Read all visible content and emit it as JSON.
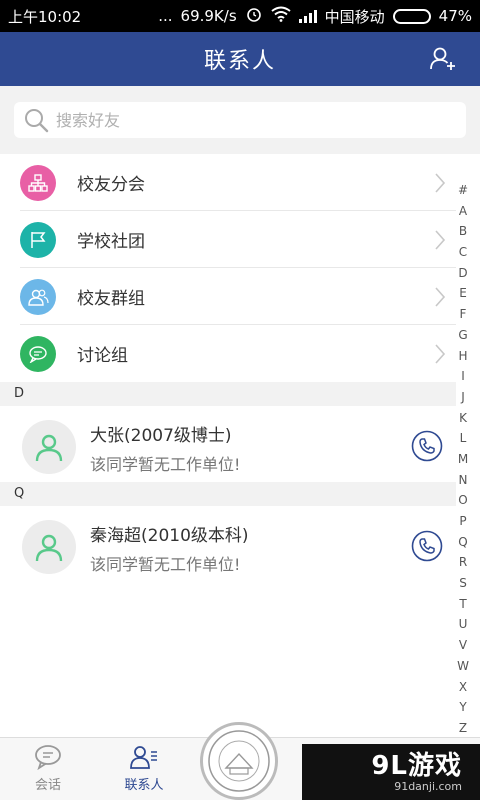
{
  "status_bar": {
    "time": "上午10:02",
    "dots": "...",
    "speed": "69.9K/s",
    "carrier": "中国移动",
    "battery": "47%",
    "battery_level": 0.47
  },
  "header": {
    "title": "联系人"
  },
  "search": {
    "placeholder": "搜索好友"
  },
  "groups": [
    {
      "label": "校友分会",
      "icon": "org-chart-icon",
      "color": "#e85fa5"
    },
    {
      "label": "学校社团",
      "icon": "flag-icon",
      "color": "#1db3a8"
    },
    {
      "label": "校友群组",
      "icon": "group-icon",
      "color": "#6cb7e8"
    },
    {
      "label": "讨论组",
      "icon": "chat-bubble-icon",
      "color": "#2fb561"
    }
  ],
  "sections": [
    {
      "letter": "D",
      "contacts": [
        {
          "name": "大张(2007级博士)",
          "work": "该同学暂无工作单位!"
        }
      ]
    },
    {
      "letter": "Q",
      "contacts": [
        {
          "name": "秦海超(2010级本科)",
          "work": "该同学暂无工作单位!"
        }
      ]
    }
  ],
  "index_letters": [
    "#",
    "A",
    "B",
    "C",
    "D",
    "E",
    "F",
    "G",
    "H",
    "I",
    "J",
    "K",
    "L",
    "M",
    "N",
    "O",
    "P",
    "Q",
    "R",
    "S",
    "T",
    "U",
    "V",
    "W",
    "X",
    "Y",
    "Z"
  ],
  "tabbar": {
    "tab_chat": "会话",
    "tab_contacts": "联系人"
  },
  "watermark": {
    "big": "9L游戏",
    "small": "91danji.com"
  },
  "colors": {
    "primary": "#2f4a92",
    "section_bg": "#f2f2f2"
  }
}
